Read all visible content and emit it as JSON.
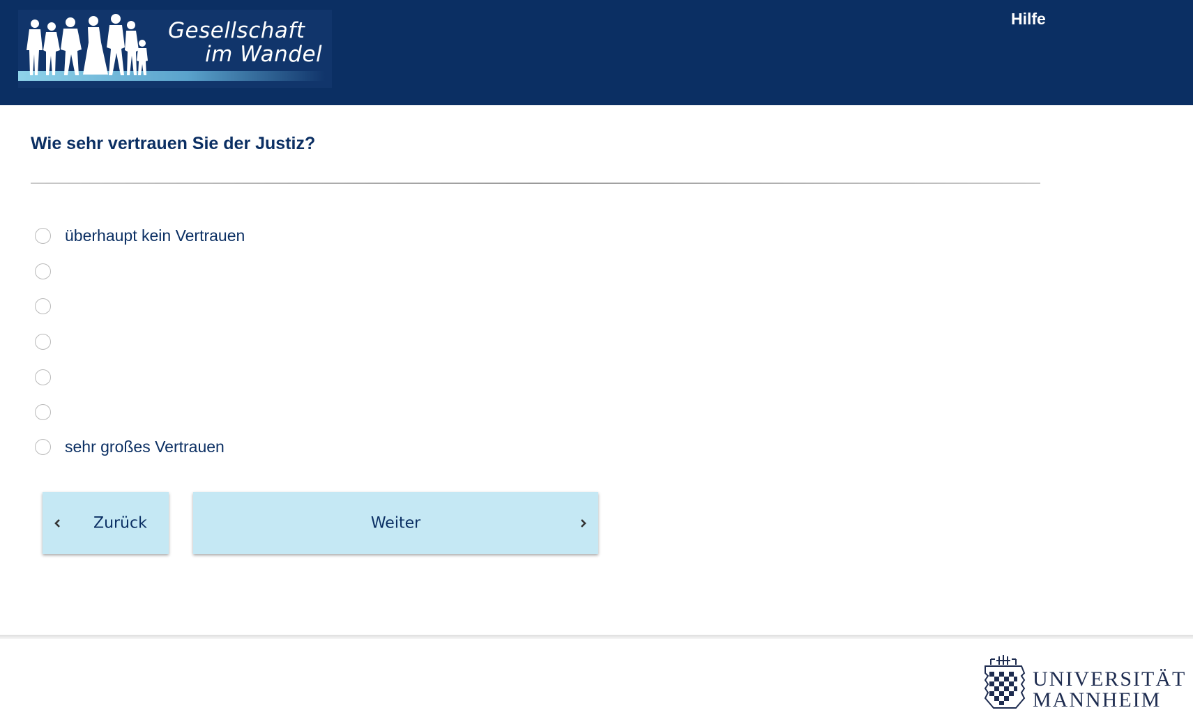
{
  "header": {
    "logo_line1": "Gesellschaft",
    "logo_line2": "im Wandel",
    "help_label": "Hilfe"
  },
  "question": {
    "title": "Wie sehr vertrauen Sie der Justiz?",
    "options": [
      {
        "label": "überhaupt kein Vertrauen",
        "selected": false
      },
      {
        "label": "",
        "selected": false
      },
      {
        "label": "",
        "selected": false
      },
      {
        "label": "",
        "selected": false
      },
      {
        "label": "",
        "selected": false
      },
      {
        "label": "",
        "selected": false
      },
      {
        "label": "sehr großes Vertrauen",
        "selected": false
      }
    ]
  },
  "nav": {
    "back_label": "Zurück",
    "next_label": "Weiter"
  },
  "footer": {
    "university_line1": "UNIVERSITÄT",
    "university_line2": "MANNHEIM"
  },
  "colors": {
    "header_bg": "#0b2f63",
    "text_primary": "#0b2f63",
    "button_bg": "#c5e8f4"
  }
}
